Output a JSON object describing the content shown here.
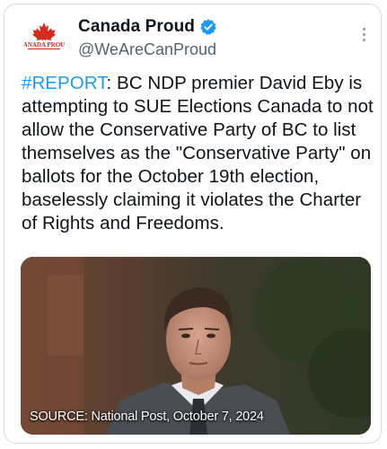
{
  "tweet": {
    "display_name": "Canada Proud",
    "handle": "@WeAreCanProud",
    "verified_icon": "verified-badge-icon",
    "more_icon": "more-options-icon",
    "avatar_logo_text": "CANADA PROUD",
    "hashtag": "#REPORT",
    "body": ": BC NDP premier David Eby is attempting to SUE Elections Canada to not allow the Conservative Party of BC to list themselves as the \"Conservative Party\" on ballots for the October 19th election, baselessly claiming it violates the Charter of Rights and Freedoms.",
    "media_caption": "SOURCE: National Post, October 7, 2024"
  },
  "colors": {
    "accent": "#1d9bf0",
    "text": "#0f1419",
    "secondary": "#536471",
    "maple_red": "#d52b1e"
  }
}
